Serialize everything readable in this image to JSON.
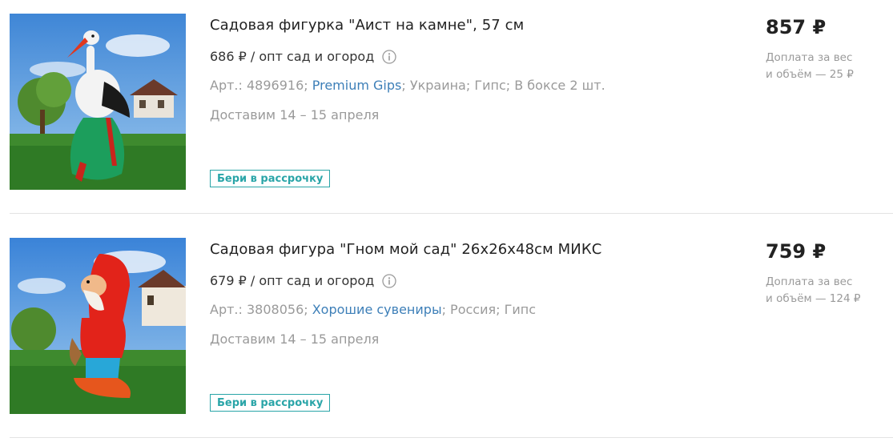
{
  "products": [
    {
      "title": "Садовая фигурка \"Аист на камне\", 57 см",
      "wholesale_price": "686 ₽ / опт сад и огород",
      "sku_prefix": "Арт.: 4896916; ",
      "brand": "Premium Gips",
      "sku_suffix": "; Украина; Гипс; В боксе 2 шт.",
      "delivery": "Доставим 14 – 15 апреля",
      "installment_label": "Бери в рассрочку",
      "price": "857 ₽",
      "surcharge_line1": "Доплата за вес",
      "surcharge_line2": "и объём — 25 ₽",
      "image_subject": "stork-figurine"
    },
    {
      "title": "Садовая фигура \"Гном мой сад\" 26х26х48см МИКС",
      "wholesale_price": "679 ₽ / опт сад и огород",
      "sku_prefix": "Арт.: 3808056; ",
      "brand": "Хорошие сувениры",
      "sku_suffix": "; Россия; Гипс",
      "delivery": "Доставим 14 – 15 апреля",
      "installment_label": "Бери в рассрочку",
      "price": "759 ₽",
      "surcharge_line1": "Доплата за вес",
      "surcharge_line2": "и объём — 124 ₽",
      "image_subject": "gnome-figurine"
    }
  ],
  "colors": {
    "link": "#3d7fb8",
    "installment": "#2aa5a8",
    "muted_text": "#9a9a9a",
    "divider": "#e3e3e3"
  },
  "icons": {
    "info": "info-circle-icon"
  }
}
